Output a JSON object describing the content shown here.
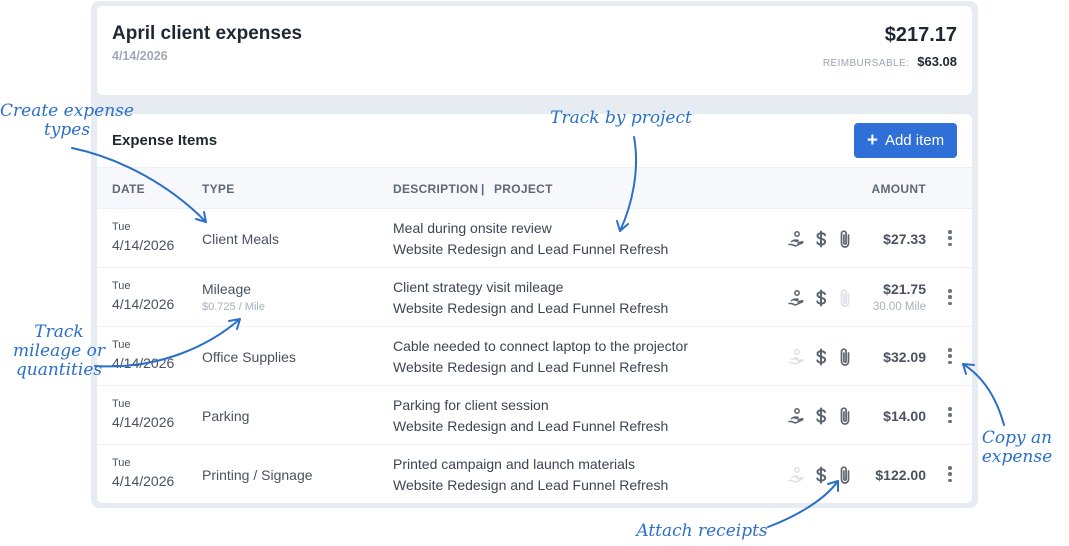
{
  "summary": {
    "title": "April client expenses",
    "date": "4/14/2026",
    "total": "$217.17",
    "reimbursable_label": "REIMBURSABLE:",
    "reimbursable_value": "$63.08"
  },
  "items": {
    "title": "Expense Items",
    "add_button": "Add item",
    "columns": {
      "date": "DATE",
      "type": "TYPE",
      "description": "DESCRIPTION",
      "separator": "|",
      "project": "PROJECT",
      "amount": "AMOUNT"
    },
    "rows": [
      {
        "day": "Tue",
        "date": "4/14/2026",
        "type": "Client Meals",
        "type_sub": "",
        "description": "Meal during onsite review",
        "project": "Website Redesign and Lead Funnel Refresh",
        "reimbursable": true,
        "billable": true,
        "receipt": true,
        "amount": "$27.33",
        "quantity": ""
      },
      {
        "day": "Tue",
        "date": "4/14/2026",
        "type": "Mileage",
        "type_sub": "$0.725 / Mile",
        "description": "Client strategy visit mileage",
        "project": "Website Redesign and Lead Funnel Refresh",
        "reimbursable": true,
        "billable": true,
        "receipt": false,
        "amount": "$21.75",
        "quantity": "30.00 Mile"
      },
      {
        "day": "Tue",
        "date": "4/14/2026",
        "type": "Office Supplies",
        "type_sub": "",
        "description": "Cable needed to connect laptop to the projector",
        "project": "Website Redesign and Lead Funnel Refresh",
        "reimbursable": false,
        "billable": true,
        "receipt": true,
        "amount": "$32.09",
        "quantity": ""
      },
      {
        "day": "Tue",
        "date": "4/14/2026",
        "type": "Parking",
        "type_sub": "",
        "description": "Parking for client session",
        "project": "Website Redesign and Lead Funnel Refresh",
        "reimbursable": true,
        "billable": true,
        "receipt": true,
        "amount": "$14.00",
        "quantity": ""
      },
      {
        "day": "Tue",
        "date": "4/14/2026",
        "type": "Printing / Signage",
        "type_sub": "",
        "description": "Printed campaign and launch materials",
        "project": "Website Redesign and Lead Funnel Refresh",
        "reimbursable": false,
        "billable": true,
        "receipt": true,
        "amount": "$122.00",
        "quantity": ""
      }
    ]
  },
  "annotations": {
    "create_types": "Create expense types",
    "track_project": "Track by project",
    "track_mileage": "Track mileage or quantities",
    "copy_expense": "Copy an expense",
    "attach_receipts": "Attach receipts"
  },
  "colors": {
    "accent": "#2e6fd8",
    "annotation": "#2a6fc9",
    "frame": "#e7ecf3"
  },
  "icons": {
    "reimbursable": "hand-coin-icon",
    "billable": "dollar-icon",
    "receipt": "paperclip-icon",
    "menu": "kebab-menu-icon",
    "add": "plus-icon"
  }
}
